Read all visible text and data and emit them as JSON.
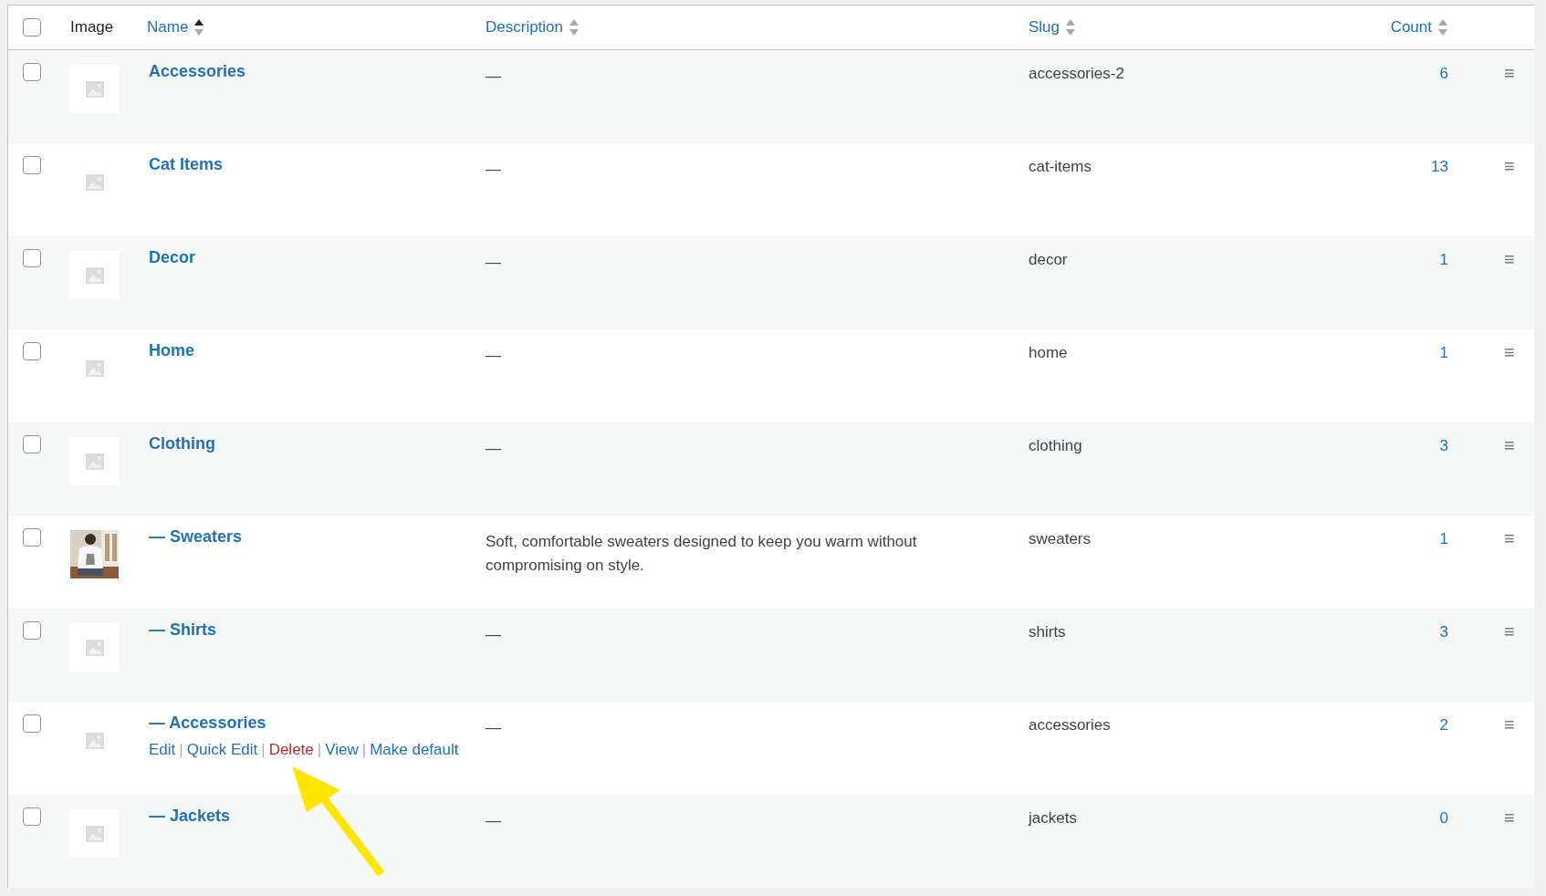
{
  "header": {
    "select_all_checked": false,
    "columns": [
      {
        "label": "Image",
        "sortable": false
      },
      {
        "label": "Name",
        "sortable": true,
        "sorted": true
      },
      {
        "label": "Description",
        "sortable": true,
        "sorted": false
      },
      {
        "label": "Slug",
        "sortable": true,
        "sorted": false
      },
      {
        "label": "Count",
        "sortable": true,
        "sorted": false
      }
    ]
  },
  "rows": [
    {
      "checked": false,
      "image": {
        "kind": "placeholder"
      },
      "name": "Accessories",
      "description": "—",
      "slug": "accessories-2",
      "count": "6",
      "drag_handle": "≡"
    },
    {
      "checked": false,
      "image": {
        "kind": "placeholder"
      },
      "name": "Cat Items",
      "description": "—",
      "slug": "cat-items",
      "count": "13",
      "drag_handle": "≡"
    },
    {
      "checked": false,
      "image": {
        "kind": "placeholder"
      },
      "name": "Decor",
      "description": "—",
      "slug": "decor",
      "count": "1",
      "drag_handle": "≡"
    },
    {
      "checked": false,
      "image": {
        "kind": "placeholder"
      },
      "name": "Home",
      "description": "—",
      "slug": "home",
      "count": "1",
      "drag_handle": "≡"
    },
    {
      "checked": false,
      "image": {
        "kind": "placeholder"
      },
      "name": "Clothing",
      "description": "—",
      "slug": "clothing",
      "count": "3",
      "drag_handle": "≡"
    },
    {
      "checked": false,
      "name": "— Sweaters",
      "description": "Soft, comfortable sweaters designed to keep you warm without compromising on style.",
      "slug": "sweaters",
      "count": "1",
      "drag_handle": "≡"
    },
    {
      "checked": false,
      "image": {
        "kind": "placeholder"
      },
      "name": "— Shirts",
      "description": "—",
      "slug": "shirts",
      "count": "3",
      "drag_handle": "≡"
    },
    {
      "checked": false,
      "image": {
        "kind": "placeholder"
      },
      "name": "— Accessories",
      "description": "—",
      "slug": "accessories",
      "count": "2",
      "drag_handle": "≡",
      "actions": [
        {
          "label": "Edit",
          "kind": "normal"
        },
        {
          "label": "Quick Edit",
          "kind": "normal"
        },
        {
          "label": "Delete",
          "kind": "danger"
        },
        {
          "label": "View",
          "kind": "normal"
        },
        {
          "label": "Make default",
          "kind": "normal"
        }
      ],
      "action_separator": "|"
    },
    {
      "checked": false,
      "image": {
        "kind": "placeholder"
      },
      "name": "— Jackets",
      "description": "—",
      "slug": "jackets",
      "count": "0",
      "drag_handle": "≡"
    }
  ]
}
